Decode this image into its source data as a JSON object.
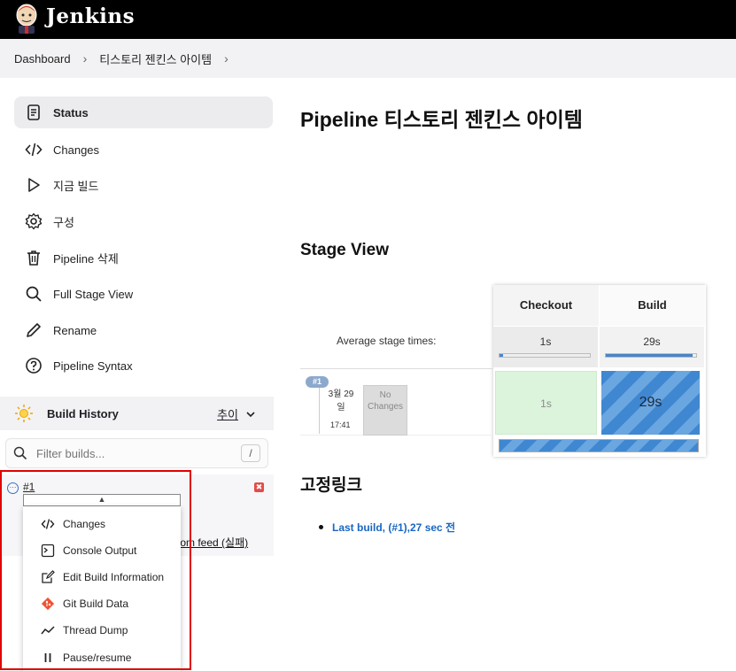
{
  "header": {
    "brand": "Jenkins"
  },
  "breadcrumbs": [
    "Dashboard",
    "티스토리 젠킨스 아이템"
  ],
  "sidebar": {
    "tasks": [
      {
        "label": "Status",
        "icon": "document-icon"
      },
      {
        "label": "Changes",
        "icon": "code-icon"
      },
      {
        "label": "지금 빌드",
        "icon": "play-icon"
      },
      {
        "label": "구성",
        "icon": "gear-icon"
      },
      {
        "label": "Pipeline 삭제",
        "icon": "trash-icon"
      },
      {
        "label": "Full Stage View",
        "icon": "search-icon"
      },
      {
        "label": "Rename",
        "icon": "pencil-icon"
      },
      {
        "label": "Pipeline Syntax",
        "icon": "help-icon"
      }
    ]
  },
  "build_history": {
    "title": "Build History",
    "trend": "추이",
    "filter_placeholder": "Filter builds...",
    "filter_shortcut": "/",
    "build_number": "#1",
    "atom_link": "tom feed (실패)"
  },
  "popup_menu": {
    "items": [
      {
        "label": "Changes",
        "icon": "code-icon"
      },
      {
        "label": "Console Output",
        "icon": "terminal-icon"
      },
      {
        "label": "Edit Build Information",
        "icon": "edit-icon"
      },
      {
        "label": "Git Build Data",
        "icon": "git-icon"
      },
      {
        "label": "Thread Dump",
        "icon": "chart-line-icon"
      },
      {
        "label": "Pause/resume",
        "icon": "pause-icon"
      }
    ]
  },
  "main": {
    "title": "Pipeline 티스토리 젠킨스 아이템",
    "stage_view_title": "Stage View",
    "stages": [
      {
        "name": "Checkout",
        "avg": "1s",
        "avg_fraction": 0.04
      },
      {
        "name": "Build",
        "avg": "29s",
        "avg_fraction": 0.96
      }
    ],
    "avg_label": "Average stage times:",
    "run": {
      "tag": "#1",
      "date_line1": "3월 29",
      "date_line2": "일",
      "time": "17:41",
      "no_changes": "No Changes",
      "cells": [
        "1s",
        "29s"
      ]
    },
    "permalinks_title": "고정링크",
    "permalinks": [
      "Last build, (#1),27 sec 전"
    ]
  }
}
